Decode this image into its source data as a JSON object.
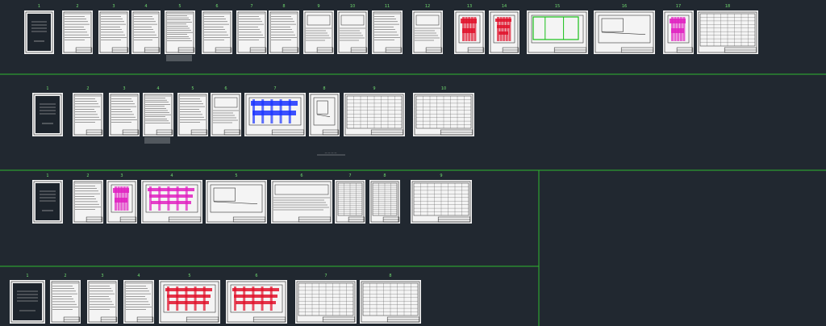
{
  "window": {
    "background": "#212830"
  },
  "colors": {
    "label": "#6fdc6f",
    "separator": "#2fb82f",
    "sheet": "#f4f4f4",
    "accent_red": "#e0102a",
    "accent_blue": "#1a33ff",
    "accent_green": "#18c018",
    "accent_magenta": "#e020c0"
  },
  "sets": [
    {
      "name": "set-1",
      "sheets": [
        {
          "label": "1",
          "kind": "cover"
        },
        {
          "label": "2",
          "kind": "text"
        },
        {
          "label": "3",
          "kind": "text-wide"
        },
        {
          "label": "4",
          "kind": "text"
        },
        {
          "label": "5",
          "kind": "text-long"
        },
        {
          "label": "6",
          "kind": "text"
        },
        {
          "label": "7",
          "kind": "text"
        },
        {
          "label": "8",
          "kind": "text"
        },
        {
          "label": "9",
          "kind": "form"
        },
        {
          "label": "10",
          "kind": "form"
        },
        {
          "label": "11",
          "kind": "text"
        },
        {
          "label": "12",
          "kind": "form"
        },
        {
          "label": "13",
          "kind": "plan-red"
        },
        {
          "label": "14",
          "kind": "plan-red-wide"
        },
        {
          "label": "15",
          "kind": "plan-green"
        },
        {
          "label": "16",
          "kind": "plan"
        },
        {
          "label": "17",
          "kind": "plan-magenta"
        },
        {
          "label": "18",
          "kind": "table"
        }
      ]
    },
    {
      "name": "set-2",
      "sheets": [
        {
          "label": "1",
          "kind": "cover"
        },
        {
          "label": "2",
          "kind": "text"
        },
        {
          "label": "3",
          "kind": "text"
        },
        {
          "label": "4",
          "kind": "text-long"
        },
        {
          "label": "5",
          "kind": "text"
        },
        {
          "label": "6",
          "kind": "form"
        },
        {
          "label": "7",
          "kind": "plan-blue"
        },
        {
          "label": "8",
          "kind": "plan"
        },
        {
          "label": "9",
          "kind": "table"
        },
        {
          "label": "10",
          "kind": "table"
        }
      ],
      "caption": "— — — —"
    },
    {
      "name": "set-3",
      "sheets": [
        {
          "label": "1",
          "kind": "cover"
        },
        {
          "label": "2",
          "kind": "text"
        },
        {
          "label": "3",
          "kind": "plan-magenta"
        },
        {
          "label": "4",
          "kind": "plan-magenta-wide"
        },
        {
          "label": "5",
          "kind": "plan"
        },
        {
          "label": "6",
          "kind": "form"
        },
        {
          "label": "7",
          "kind": "table-tall"
        },
        {
          "label": "8",
          "kind": "table-tall"
        },
        {
          "label": "9",
          "kind": "table"
        }
      ]
    },
    {
      "name": "set-4",
      "sheets": [
        {
          "label": "1",
          "kind": "cover"
        },
        {
          "label": "2",
          "kind": "text"
        },
        {
          "label": "3",
          "kind": "text"
        },
        {
          "label": "4",
          "kind": "text"
        },
        {
          "label": "5",
          "kind": "plan-red-wide"
        },
        {
          "label": "6",
          "kind": "plan-red-wide"
        },
        {
          "label": "7",
          "kind": "table"
        },
        {
          "label": "8",
          "kind": "table"
        }
      ]
    }
  ]
}
